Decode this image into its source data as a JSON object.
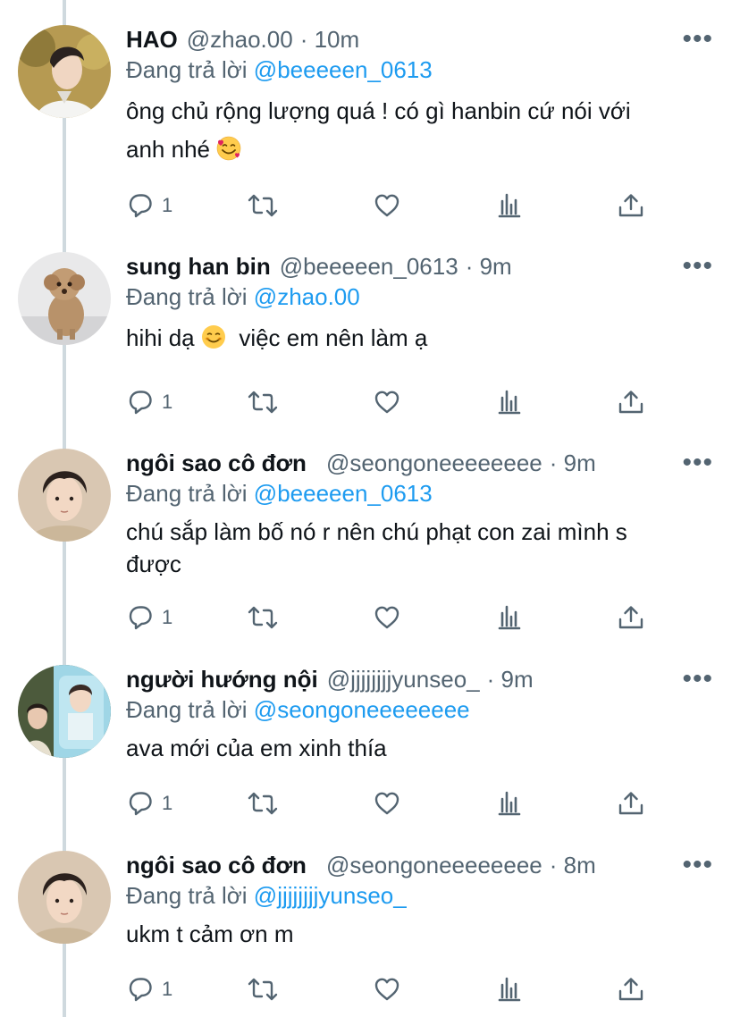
{
  "colors": {
    "text": "#0f1419",
    "secondary": "#536471",
    "link": "#1d9bf0",
    "thread_line": "#cfd9de"
  },
  "reply_prefix": "Đang trả lời",
  "tweets": [
    {
      "name": "HAO",
      "handle": "@zhao.00",
      "time": "· 10m",
      "reply_to": "@beeeeen_0613",
      "text_lines": [
        "ông chủ rộng lượng quá ! có gì hanbin cứ nói với",
        "anh nhé"
      ],
      "emoji": "smiling-face-with-hearts",
      "reply_count": "1"
    },
    {
      "name": "sung han bin",
      "handle": "@beeeeen_0613",
      "time": "· 9m",
      "reply_to": "@zhao.00",
      "text_before_emoji": "hihi dạ",
      "emoji": "smiling-face",
      "text_after_emoji": "việc em nên làm ạ",
      "reply_count": "1"
    },
    {
      "name": "ngôi sao cô đơn",
      "handle": "@seongoneeeeeeee",
      "time": "· 9m",
      "reply_to": "@beeeeen_0613",
      "text_lines": [
        "chú sắp làm bố nó r nên chú phạt con zai mình s",
        "được"
      ],
      "reply_count": "1"
    },
    {
      "name": "người hướng nội",
      "handle": "@jjjjjjjjyunseo_",
      "time": "· 9m",
      "reply_to": "@seongoneeeeeeee",
      "text_lines": [
        "ava mới của em xinh thía"
      ],
      "reply_count": "1"
    },
    {
      "name": "ngôi sao cô đơn",
      "handle": "@seongoneeeeeeee",
      "time": "· 8m",
      "reply_to": "@jjjjjjjjyunseo_",
      "text_lines": [
        "ukm t cảm ơn m"
      ],
      "reply_count": "1"
    }
  ],
  "icons": {
    "more": "more-icon",
    "reply": "reply-icon",
    "retweet": "retweet-icon",
    "like": "heart-icon",
    "analytics": "analytics-icon",
    "share": "share-icon"
  },
  "more_glyph": "•••"
}
